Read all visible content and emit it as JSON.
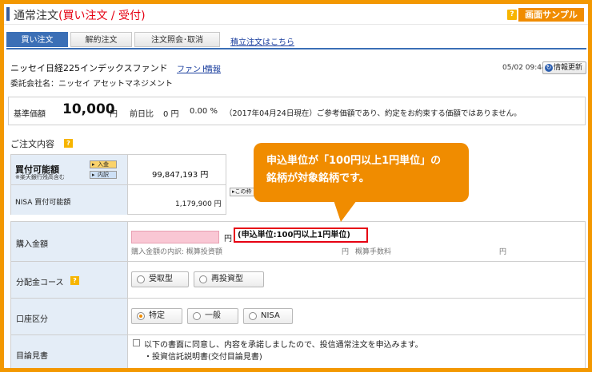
{
  "header": {
    "title_main": "通常注文",
    "title_paren": "(買い注文 / 受付)",
    "help_icon_text": "?",
    "sample_label": "画面サンプル"
  },
  "tabs": [
    {
      "label": "買い注文",
      "active": true
    },
    {
      "label": "解約注文",
      "active": false
    },
    {
      "label": "注文照会･取消",
      "active": false
    }
  ],
  "links": {
    "regular_order": "積立注文はこちら"
  },
  "fund": {
    "name": "ニッセイ日経225インデックスファンド",
    "link_fund": "ファンド",
    "link_info": "情報",
    "company_label": "委託会社名：ニッセイ アセットマネジメント",
    "timestamp": "05/02 09:44",
    "refresh_label": "情報更新"
  },
  "price": {
    "label": "基準価額",
    "value": "10,000",
    "unit": "円",
    "change_label": "前日比",
    "change_value": "0 円",
    "change_pct": "0.00 %",
    "note": "（2017年04月24日現在）ご参考価額であり、約定をお約束する価額ではありません。"
  },
  "section": {
    "title": "ご注文内容"
  },
  "buying_power": {
    "label": "買付可能額",
    "sublabel": "※楽天銀行残高含む",
    "btn_deposit": "入金",
    "btn_detail": "内訳",
    "value": "99,847,193 円",
    "nisa_label": "NISA 買付可能額",
    "nisa_value": "1,179,900 円",
    "frame_tab": "この枠"
  },
  "order": {
    "amount_label": "購入金額",
    "amount_value": "",
    "amount_unit": "円",
    "unit_note": "(申込単位:100円以上1円単位)",
    "breakdown_label": "購入金額の内訳: 概算投資額",
    "breakdown_yen1": "円",
    "breakdown_fee": "概算手数料",
    "breakdown_yen2": "円",
    "course_label": "分配金コース",
    "course_options": [
      "受取型",
      "再投資型"
    ],
    "account_label": "口座区分",
    "account_options": [
      "特定",
      "一般",
      "NISA"
    ],
    "account_selected": "特定",
    "prospectus_label": "目論見書",
    "agree_text": "以下の書面に同意し、内容を承諾しましたので、投信通常注文を申込みます。",
    "doc_text": "・投資信託説明書(交付目論見書)"
  },
  "callout": {
    "line1": "申込単位が「100円以上1円単位」の",
    "line2": "銘柄が対象銘柄です。"
  }
}
